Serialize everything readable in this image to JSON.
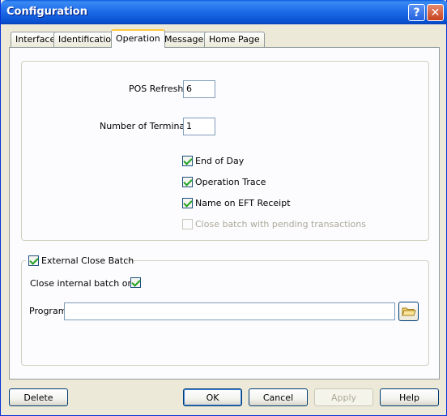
{
  "window": {
    "title": "Configuration"
  },
  "tabs": [
    {
      "label": "Interface"
    },
    {
      "label": "Identification"
    },
    {
      "label": "Operation",
      "active": true
    },
    {
      "label": "Message"
    },
    {
      "label": "Home Page"
    }
  ],
  "operation": {
    "pos_refresh": {
      "label": "POS Refresh",
      "value": "6"
    },
    "num_terminals": {
      "label": "Number of Terminals",
      "value": "1"
    },
    "checkboxes": [
      {
        "label": "End of Day",
        "checked": true,
        "enabled": true
      },
      {
        "label": "Operation Trace",
        "checked": true,
        "enabled": true
      },
      {
        "label": "Name on EFT Receipt",
        "checked": true,
        "enabled": true
      },
      {
        "label": "Close batch with pending transactions",
        "checked": false,
        "enabled": false
      }
    ],
    "external_close_batch": {
      "label": "External Close Batch",
      "checked": true
    },
    "close_internal_only": {
      "label": "Close internal batch only",
      "checked": true
    },
    "program": {
      "label": "Program",
      "value": ""
    }
  },
  "buttons": {
    "delete": "Delete",
    "ok": "OK",
    "cancel": "Cancel",
    "apply": "Apply",
    "help": "Help"
  },
  "colors": {
    "titlebar": "#0a50d0",
    "dialog_bg": "#ece9d8",
    "check_mark": "#21a121",
    "active_tab_accent": "#ffc83c"
  }
}
